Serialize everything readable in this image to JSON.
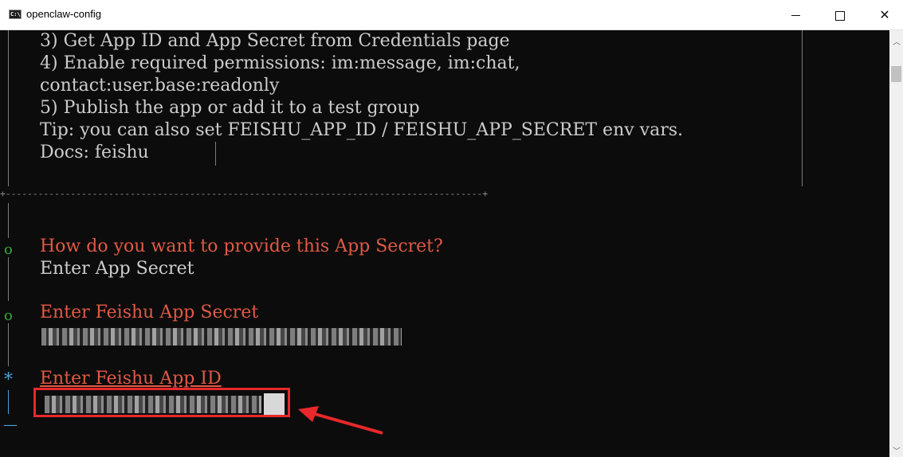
{
  "window": {
    "title": "openclaw-config",
    "app_icon_text": "C:\\"
  },
  "lines": {
    "l1": "3) Get App ID and App Secret from Credentials page",
    "l2": "4) Enable required permissions: im:message, im:chat,",
    "l3": "contact:user.base:readonly",
    "l4": "5) Publish the app or add it to a test group",
    "l5": "Tip: you can also set FEISHU_APP_ID / FEISHU_APP_SECRET env vars.",
    "l6": "Docs: feishu",
    "separator": "+----------------------------------------------------------------------------------------+",
    "q1_marker": "o",
    "q1_prompt": "How do you want to provide this App Secret?",
    "q1_answer": "Enter App Secret",
    "q2_marker": "o",
    "q2_prompt": "Enter Feishu App Secret",
    "q3_marker": "*",
    "q3_prompt": "Enter Feishu App ID",
    "end_marker": "—"
  },
  "colors": {
    "prompt": "#e05a46",
    "text": "#cccccc",
    "done_marker": "#3aa53a",
    "active_marker": "#4a9fd5",
    "highlight": "#e8282b"
  }
}
